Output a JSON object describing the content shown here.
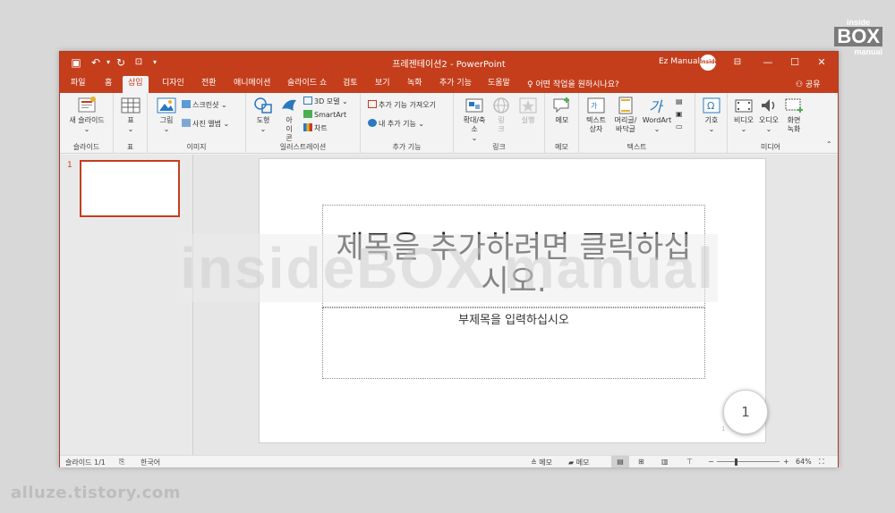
{
  "app": {
    "doc_title": "프레젠테이션2  -  PowerPoint",
    "user_name": "Ez Manual",
    "avatar_text": "Inside"
  },
  "tabs": [
    "파일",
    "홈",
    "삽입",
    "디자인",
    "전환",
    "애니메이션",
    "슬라이드 쇼",
    "검토",
    "보기",
    "녹화",
    "추가 기능",
    "도움말"
  ],
  "active_tab": "삽입",
  "tell_me": "어떤 작업을 원하시나요?",
  "share": "공유",
  "ribbon": {
    "slides": {
      "new_slide": "새 슬라이드",
      "label": "슬라이드"
    },
    "tables": {
      "table": "표",
      "label": "표"
    },
    "images": {
      "pictures": "그림",
      "screenshot": "스크린샷",
      "photo_album": "사진 앨범",
      "label": "이미지"
    },
    "illustrations": {
      "shapes": "도형",
      "icons": "아이콘",
      "models_3d": "3D 모델",
      "smartart": "SmartArt",
      "chart": "차트",
      "label": "일러스트레이션"
    },
    "addins": {
      "get_addins": "추가 기능 가져오기",
      "my_addins": "내 추가 기능",
      "label": "추가 기능"
    },
    "links": {
      "zoom": "확대/축소",
      "link": "링크",
      "action": "실행",
      "label": "링크"
    },
    "comments": {
      "comment": "메모",
      "label": "메모"
    },
    "text": {
      "textbox": "텍스트 상자",
      "header_footer": "머리글/바닥글",
      "wordart": "WordArt",
      "label": "텍스트"
    },
    "symbols": {
      "symbol": "기호"
    },
    "media": {
      "video": "비디오",
      "audio": "오디오",
      "screen_recording": "화면 녹화",
      "label": "미디어"
    }
  },
  "thumbnail": {
    "number": "1"
  },
  "slide": {
    "title": "제목을 추가하려면 클릭하십시오.",
    "subtitle": "부제목을 입력하십시오",
    "page_number": "1",
    "page_number_small": "1"
  },
  "watermark": "insideBOX manual",
  "statusbar": {
    "slide_counter": "슬라이드 1/1",
    "language": "한국어",
    "notes": "메모",
    "comments": "메모",
    "zoom": "64%"
  },
  "corner_logo": {
    "line1": "inside",
    "line2": "BOX",
    "line3": "manual"
  },
  "blog_url": "alluze.tistory.com",
  "colors": {
    "accent": "#c43e1c",
    "ribbon_bg": "#f3f3f3",
    "workspace_bg": "#e6e6e6"
  }
}
